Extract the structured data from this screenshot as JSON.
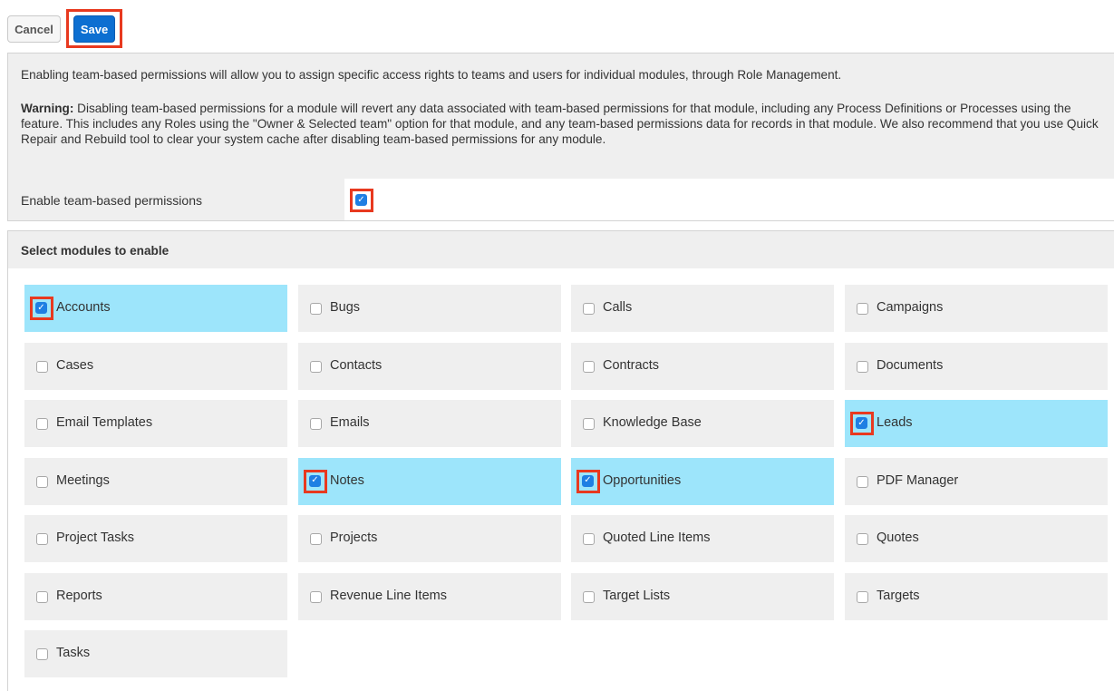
{
  "toolbar": {
    "cancel_label": "Cancel",
    "save_label": "Save"
  },
  "info": {
    "intro": "Enabling team-based permissions will allow you to assign specific access rights to teams and users for individual modules, through Role Management.",
    "warning_label": "Warning:",
    "warning_text": " Disabling team-based permissions for a module will revert any data associated with team-based permissions for that module, including any Process Definitions or Processes using the feature. This includes any Roles using the \"Owner & Selected team\" option for that module, and any team-based permissions data for records in that module. We also recommend that you use Quick Repair and Rebuild tool to clear your system cache after disabling team-based permissions for any module."
  },
  "enable": {
    "label": "Enable team-based permissions",
    "checked": true
  },
  "modules": {
    "title": "Select modules to enable",
    "items": [
      {
        "label": "Accounts",
        "checked": true
      },
      {
        "label": "Bugs",
        "checked": false
      },
      {
        "label": "Calls",
        "checked": false
      },
      {
        "label": "Campaigns",
        "checked": false
      },
      {
        "label": "Cases",
        "checked": false
      },
      {
        "label": "Contacts",
        "checked": false
      },
      {
        "label": "Contracts",
        "checked": false
      },
      {
        "label": "Documents",
        "checked": false
      },
      {
        "label": "Email Templates",
        "checked": false
      },
      {
        "label": "Emails",
        "checked": false
      },
      {
        "label": "Knowledge Base",
        "checked": false
      },
      {
        "label": "Leads",
        "checked": true
      },
      {
        "label": "Meetings",
        "checked": false
      },
      {
        "label": "Notes",
        "checked": true
      },
      {
        "label": "Opportunities",
        "checked": true
      },
      {
        "label": "PDF Manager",
        "checked": false
      },
      {
        "label": "Project Tasks",
        "checked": false
      },
      {
        "label": "Projects",
        "checked": false
      },
      {
        "label": "Quoted Line Items",
        "checked": false
      },
      {
        "label": "Quotes",
        "checked": false
      },
      {
        "label": "Reports",
        "checked": false
      },
      {
        "label": "Revenue Line Items",
        "checked": false
      },
      {
        "label": "Target Lists",
        "checked": false
      },
      {
        "label": "Targets",
        "checked": false
      },
      {
        "label": "Tasks",
        "checked": false
      }
    ]
  },
  "colors": {
    "save_button": "#0d6fd1",
    "checked_cell": "#9de5fb",
    "checkbox_on": "#1f7fe3",
    "highlight": "#e8391f"
  }
}
